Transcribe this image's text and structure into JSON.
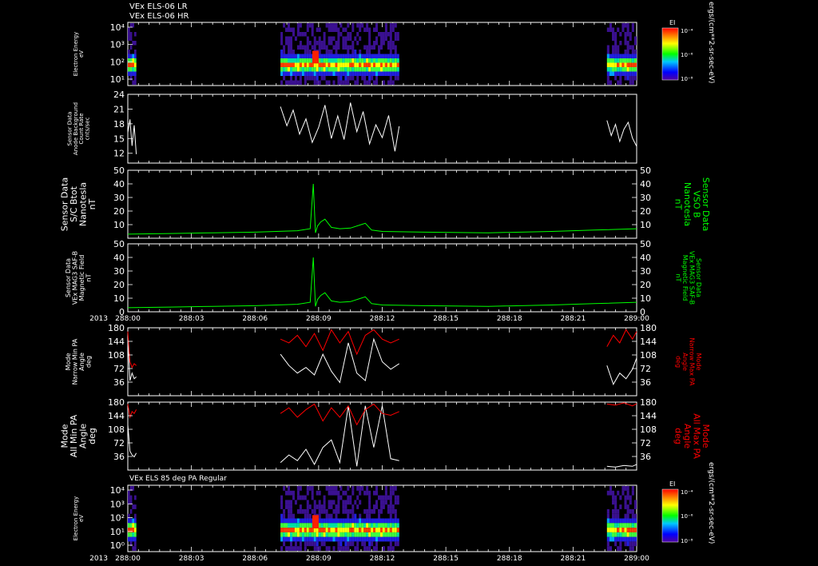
{
  "header": {
    "title_line1": "VEx ELS-06 LR",
    "title_line2": "VEx ELS-06 HR",
    "mid_title": "VEx ELS 85 deg PA Regular"
  },
  "colors": {
    "background": "#000000",
    "white_trace": "#ffffff",
    "green_trace": "#00ff00",
    "red_trace": "#ff0000",
    "green_label": "#00ff00",
    "red_label": "#ff0000"
  },
  "colorbar": {
    "title": "EI",
    "ticks": [
      "10⁻⁴",
      "10⁻⁶",
      "10⁻⁸"
    ],
    "units": "ergs/(cm**2-sr-sec-eV)"
  },
  "time_axis": {
    "year": "2013",
    "ticks": [
      "288:00",
      "288:03",
      "288:06",
      "288:09",
      "288:12",
      "288:15",
      "288:18",
      "288:21",
      "289:00"
    ]
  },
  "chart_data": [
    {
      "type": "heatmap",
      "panel": "energy_lr_hr",
      "ylabel": [
        "Electron Energy",
        "eV"
      ],
      "y_ticks": [
        "10⁴",
        "10³",
        "10²",
        "10¹"
      ],
      "y_scale": "log",
      "data_intervals_hours": [
        [
          0.0,
          0.4
        ],
        [
          7.2,
          12.8
        ],
        [
          22.6,
          24.0
        ]
      ]
    },
    {
      "type": "line",
      "panel": "anode_background",
      "ylabel": [
        "Sensor Data",
        "Anode Background",
        "Count Rate",
        "cnts/sec"
      ],
      "ylim": [
        10,
        24
      ],
      "y_ticks": [
        "24",
        "21",
        "18",
        "15",
        "12"
      ],
      "series": [
        {
          "color": "#ffffff",
          "x": [
            0.0,
            0.1,
            0.2,
            0.3,
            0.4,
            null,
            7.2,
            7.5,
            7.8,
            8.1,
            8.4,
            8.7,
            9.0,
            9.3,
            9.6,
            9.9,
            10.2,
            10.5,
            10.8,
            11.1,
            11.4,
            11.7,
            12.0,
            12.3,
            12.6,
            12.8,
            null,
            22.6,
            22.8,
            23.0,
            23.2,
            23.4,
            23.6,
            23.8,
            24.0
          ],
          "y": [
            16.2,
            18.9,
            13.5,
            17.7,
            11.8,
            null,
            21.5,
            17.6,
            20.8,
            15.9,
            19.0,
            14.2,
            17.3,
            21.8,
            15.0,
            19.6,
            14.8,
            22.3,
            16.4,
            20.5,
            13.9,
            17.8,
            15.2,
            19.7,
            12.4,
            17.5,
            null,
            18.7,
            15.6,
            17.9,
            14.4,
            16.9,
            18.3,
            15.1,
            13.4
          ]
        }
      ]
    },
    {
      "type": "line",
      "panel": "sc_bmag",
      "ylabel": [
        "Sensor Data",
        "S/C Btot",
        "Nanotesla",
        "nT"
      ],
      "ylabel_right": [
        "Sensor Data",
        "VSO B",
        "Nanotesla",
        "nT"
      ],
      "ylim": [
        0,
        50
      ],
      "y_ticks": [
        "50",
        "40",
        "30",
        "20",
        "10"
      ],
      "series": [
        {
          "color": "#00ff00",
          "x": [
            0,
            2,
            4,
            6,
            7,
            8,
            8.6,
            8.75,
            8.85,
            8.95,
            9.1,
            9.3,
            9.6,
            10,
            10.5,
            11,
            11.2,
            11.5,
            12,
            14,
            17,
            20,
            22,
            24
          ],
          "y": [
            3,
            3.5,
            4,
            4.5,
            5,
            5.5,
            7,
            40,
            4,
            9,
            12,
            14,
            8,
            7,
            7.5,
            10,
            11,
            6,
            5,
            4.5,
            4,
            5,
            6,
            7
          ]
        }
      ]
    },
    {
      "type": "line",
      "panel": "mag3_safb",
      "ylabel": [
        "Sensor Data",
        "VEx MAG3 SAF-B",
        "Magnetic Field",
        "nT"
      ],
      "ylabel_right": [
        "Sensor Data",
        "VEx MAG3 SAF-B",
        "Magnetic Field",
        "nT"
      ],
      "ylim": [
        0,
        50
      ],
      "y_ticks": [
        "50",
        "40",
        "30",
        "20",
        "10",
        "0"
      ],
      "series": [
        {
          "color": "#00ff00",
          "x": [
            0,
            2,
            4,
            6,
            7,
            8,
            8.6,
            8.75,
            8.85,
            8.95,
            9.1,
            9.3,
            9.6,
            10,
            10.5,
            11,
            11.2,
            11.5,
            12,
            14,
            17,
            20,
            22,
            24
          ],
          "y": [
            3,
            3.5,
            4,
            4.5,
            5,
            5.5,
            7,
            40,
            4,
            9,
            12,
            14,
            8,
            7,
            7.5,
            10,
            11,
            6,
            5,
            4.5,
            4,
            5,
            6,
            7
          ]
        }
      ]
    },
    {
      "type": "line",
      "panel": "narrow_pa",
      "ylabel": [
        "Mode",
        "Narrow Min PA",
        "Angle",
        "deg"
      ],
      "ylabel_right": [
        "Mode",
        "Narrow Max PA",
        "Angle",
        "deg"
      ],
      "ylim": [
        0,
        180
      ],
      "y_ticks": [
        "180",
        "144",
        "108",
        "72",
        "36"
      ],
      "series": [
        {
          "name": "Narrow Min PA",
          "color": "#ffffff",
          "x": [
            0.0,
            0.1,
            0.2,
            0.3,
            0.4,
            null,
            7.2,
            7.6,
            8.0,
            8.4,
            8.8,
            9.2,
            9.6,
            10.0,
            10.4,
            10.8,
            11.2,
            11.6,
            12.0,
            12.4,
            12.8,
            null,
            22.6,
            22.9,
            23.2,
            23.5,
            23.8,
            24.0
          ],
          "y": [
            150,
            40,
            60,
            45,
            50,
            null,
            110,
            80,
            60,
            75,
            55,
            110,
            65,
            35,
            140,
            60,
            40,
            150,
            90,
            70,
            85,
            null,
            80,
            30,
            60,
            45,
            70,
            100
          ]
        },
        {
          "name": "Narrow Max PA",
          "color": "#ff0000",
          "x": [
            0.0,
            0.1,
            0.2,
            0.3,
            0.4,
            null,
            7.2,
            7.6,
            8.0,
            8.4,
            8.8,
            9.2,
            9.6,
            10.0,
            10.4,
            10.8,
            11.2,
            11.6,
            12.0,
            12.4,
            12.8,
            null,
            22.6,
            22.9,
            23.2,
            23.5,
            23.8,
            24.0
          ],
          "y": [
            170,
            90,
            75,
            85,
            80,
            null,
            150,
            140,
            160,
            130,
            165,
            120,
            175,
            140,
            170,
            110,
            160,
            175,
            150,
            140,
            150,
            null,
            130,
            160,
            140,
            175,
            150,
            170
          ]
        }
      ]
    },
    {
      "type": "line",
      "panel": "all_pa",
      "ylabel": [
        "Mode",
        "All Min PA",
        "Angle",
        "deg"
      ],
      "ylabel_right": [
        "Mode",
        "All Max PA",
        "Angle",
        "deg"
      ],
      "ylim": [
        0,
        180
      ],
      "y_ticks": [
        "180",
        "144",
        "108",
        "72",
        "36"
      ],
      "series": [
        {
          "name": "All Min PA",
          "color": "#ffffff",
          "x": [
            0.0,
            0.1,
            0.2,
            0.3,
            0.4,
            null,
            7.2,
            7.6,
            8.0,
            8.4,
            8.8,
            9.2,
            9.6,
            10.0,
            10.4,
            10.8,
            11.2,
            11.6,
            12.0,
            12.4,
            12.8,
            null,
            22.6,
            23.0,
            23.4,
            23.8,
            24.0
          ],
          "y": [
            120,
            50,
            40,
            35,
            45,
            null,
            20,
            40,
            25,
            55,
            15,
            60,
            80,
            20,
            170,
            10,
            170,
            60,
            170,
            30,
            25,
            null,
            10,
            8,
            12,
            10,
            15
          ]
        },
        {
          "name": "All Max PA",
          "color": "#ff0000",
          "x": [
            0.0,
            0.1,
            0.2,
            0.3,
            0.4,
            null,
            7.2,
            7.6,
            8.0,
            8.4,
            8.8,
            9.2,
            9.6,
            10.0,
            10.4,
            10.8,
            11.2,
            11.6,
            12.0,
            12.4,
            12.8,
            null,
            22.6,
            23.0,
            23.4,
            23.8,
            24.0
          ],
          "y": [
            175,
            140,
            155,
            150,
            160,
            null,
            150,
            165,
            140,
            160,
            175,
            130,
            165,
            140,
            170,
            120,
            160,
            175,
            150,
            145,
            155,
            null,
            175,
            172,
            178,
            170,
            176
          ]
        }
      ]
    },
    {
      "type": "heatmap",
      "panel": "energy_85deg",
      "ylabel": [
        "Electron Energy",
        "eV"
      ],
      "y_ticks": [
        "10⁴",
        "10³",
        "10²",
        "10¹",
        "10⁰"
      ],
      "y_scale": "log",
      "data_intervals_hours": [
        [
          0.0,
          0.4
        ],
        [
          7.2,
          12.8
        ],
        [
          22.6,
          24.0
        ]
      ]
    }
  ]
}
